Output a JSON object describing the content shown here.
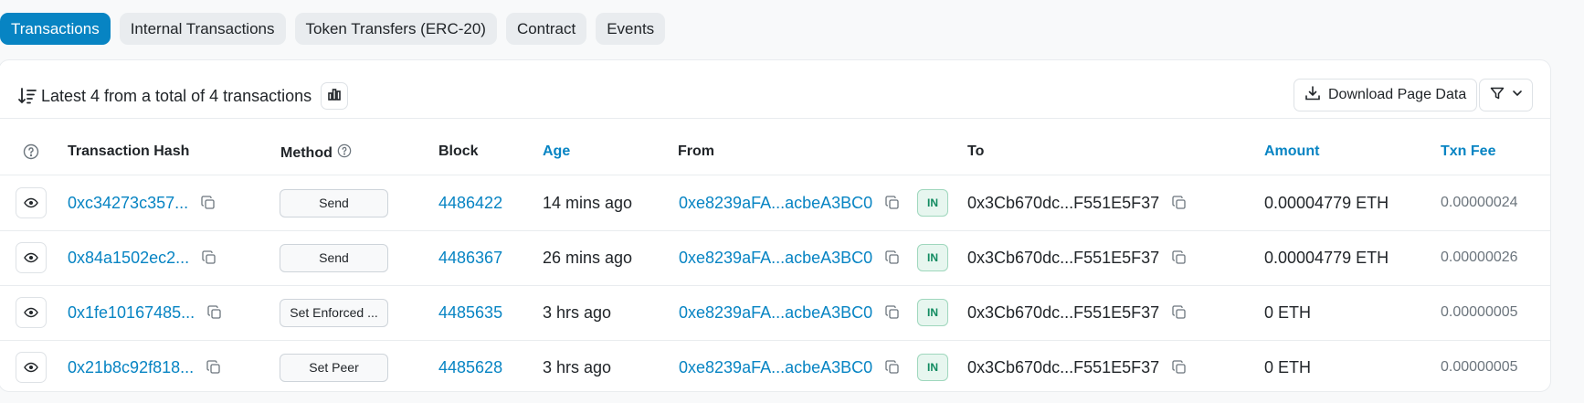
{
  "tabs": [
    "Transactions",
    "Internal Transactions",
    "Token Transfers (ERC-20)",
    "Contract",
    "Events"
  ],
  "summary": {
    "text": "Latest 4 from a total of 4 transactions"
  },
  "toolbar": {
    "download_label": "Download Page Data"
  },
  "columns": {
    "hash": "Transaction Hash",
    "method": "Method",
    "block": "Block",
    "age": "Age",
    "from": "From",
    "to": "To",
    "amount": "Amount",
    "fee": "Txn Fee"
  },
  "rows": [
    {
      "hash": "0xc34273c357...",
      "method": "Send",
      "block": "4486422",
      "age": "14 mins ago",
      "from": "0xe8239aFA...acbeA3BC0",
      "direction": "IN",
      "to": "0x3Cb670dc...F551E5F37",
      "amount": "0.00004779 ETH",
      "fee": "0.00000024"
    },
    {
      "hash": "0x84a1502ec2...",
      "method": "Send",
      "block": "4486367",
      "age": "26 mins ago",
      "from": "0xe8239aFA...acbeA3BC0",
      "direction": "IN",
      "to": "0x3Cb670dc...F551E5F37",
      "amount": "0.00004779 ETH",
      "fee": "0.00000026"
    },
    {
      "hash": "0x1fe10167485...",
      "method": "Set Enforced ...",
      "block": "4485635",
      "age": "3 hrs ago",
      "from": "0xe8239aFA...acbeA3BC0",
      "direction": "IN",
      "to": "0x3Cb670dc...F551E5F37",
      "amount": "0 ETH",
      "fee": "0.00000005"
    },
    {
      "hash": "0x21b8c92f818...",
      "method": "Set Peer",
      "block": "4485628",
      "age": "3 hrs ago",
      "from": "0xe8239aFA...acbeA3BC0",
      "direction": "IN",
      "to": "0x3Cb670dc...F551E5F37",
      "amount": "0 ETH",
      "fee": "0.00000005"
    }
  ],
  "colors": {
    "accent": "#0784c3",
    "in_badge_bg": "#e7f6ef",
    "in_badge_text": "#0f8a5f"
  }
}
